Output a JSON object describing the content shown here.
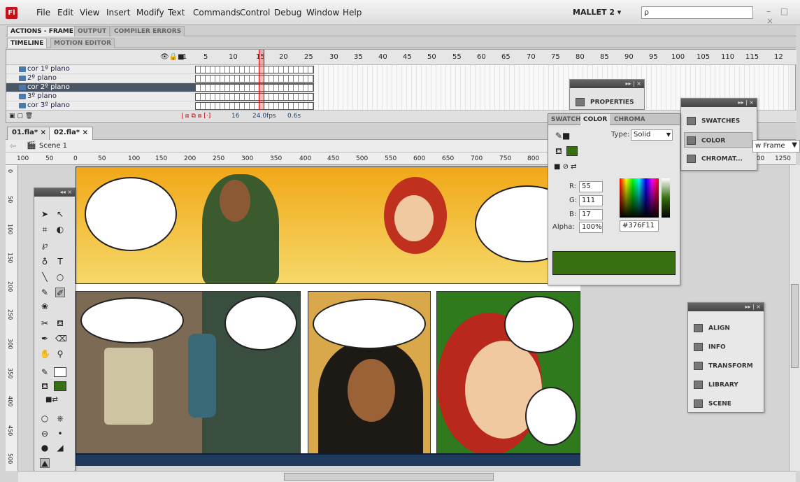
{
  "app": {
    "logo": "Fl",
    "workspace": "MALLET 2 ▾",
    "search_placeholder": "ρ",
    "window_controls": "– □ ×"
  },
  "menu": [
    "File",
    "Edit",
    "View",
    "Insert",
    "Modify",
    "Text",
    "Commands",
    "Control",
    "Debug",
    "Window",
    "Help"
  ],
  "top_tabs": [
    "ACTIONS - FRAME",
    "OUTPUT",
    "COMPILER ERRORS"
  ],
  "timeline_tabs": [
    "TIMELINE",
    "MOTION EDITOR"
  ],
  "frame_numbers": [
    "1",
    "5",
    "10",
    "15",
    "20",
    "25",
    "30",
    "35",
    "40",
    "45",
    "50",
    "55",
    "60",
    "65",
    "70",
    "75",
    "80",
    "85",
    "90",
    "95",
    "100",
    "105",
    "110",
    "115",
    "12"
  ],
  "layers": [
    {
      "name": "cor 1º plano",
      "selected": false
    },
    {
      "name": "2º plano",
      "selected": false
    },
    {
      "name": "cor 2º plano",
      "selected": true
    },
    {
      "name": "3º plano",
      "selected": false
    },
    {
      "name": "cor 3º plano",
      "selected": false
    }
  ],
  "timeline_footer": {
    "frame": "16",
    "fps": "24.0fps",
    "time": "0.6s"
  },
  "doc_tabs": [
    "01.fla* ×",
    "02.fla* ×"
  ],
  "scene": "Scene 1",
  "view_dropdown": "w Frame",
  "ruler_labels": [
    "100",
    "50",
    "0",
    "50",
    "100",
    "150",
    "200",
    "250",
    "300",
    "350",
    "400",
    "450",
    "500",
    "550",
    "600",
    "650",
    "700",
    "750",
    "800",
    "200",
    "1250"
  ],
  "vruler_labels": [
    "0",
    "50",
    "100",
    "150",
    "200",
    "250",
    "300",
    "350",
    "400",
    "450",
    "500"
  ],
  "properties_panel": {
    "label": "PROPERTIES"
  },
  "color_panel": {
    "tabs": [
      "SWATCH",
      "COLOR",
      "CHROMA"
    ],
    "type_label": "Type:",
    "type_value": "Solid",
    "r_label": "R:",
    "r": "55",
    "g_label": "G:",
    "g": "111",
    "b_label": "B:",
    "b": "17",
    "alpha_label": "Alpha:",
    "alpha": "100%",
    "hex": "#376F11",
    "fill_color": "#376f11"
  },
  "swatch_panel": {
    "items": [
      "SWATCHES",
      "COLOR",
      "CHROMAT..."
    ]
  },
  "align_panel": {
    "items": [
      "ALIGN",
      "INFO",
      "TRANSFORM",
      "LIBRARY",
      "SCENE"
    ]
  },
  "colors": {
    "accent_fill": "#376f11",
    "comic_sky": "#f1b020"
  }
}
